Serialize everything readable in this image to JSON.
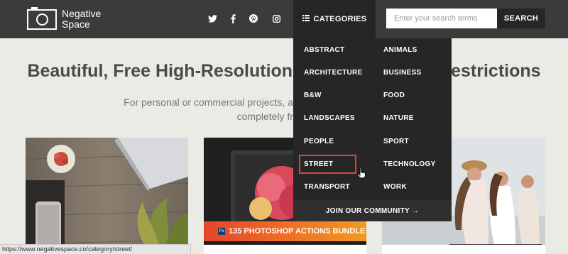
{
  "header": {
    "logo_line1": "Negative",
    "logo_line2": "Space",
    "social_icons": [
      "twitter-icon",
      "facebook-icon",
      "pinterest-icon",
      "instagram-icon"
    ],
    "categories_label": "CATEGORIES",
    "search_placeholder": "Enter your search terms",
    "search_button": "SEARCH"
  },
  "hero": {
    "title_left": "Beautiful, Free High-Resolution",
    "title_right": "Restrictions",
    "sub_line1_left": "For personal or commercial projects, a",
    "sub_line2_left": "completely fr"
  },
  "dropdown": {
    "left_items": [
      "ABSTRACT",
      "ARCHITECTURE",
      "B&W",
      "LANDSCAPES",
      "PEOPLE",
      "STREET",
      "TRANSPORT"
    ],
    "right_items": [
      "ANIMALS",
      "BUSINESS",
      "FOOD",
      "NATURE",
      "SPORT",
      "TECHNOLOGY",
      "WORK"
    ],
    "footer": "JOIN OUR COMMUNITY →",
    "highlighted": "STREET"
  },
  "cards": {
    "banner_badge": "Ps",
    "banner_text": "135 PHOTOSHOP ACTIONS BUNDLE"
  },
  "status_url": "https://www.negativespace.co/category/street/",
  "colors": {
    "header_bg": "#3b3b3b",
    "dropdown_bg": "#262626",
    "page_bg": "#ebebe6",
    "highlight_border": "#d94444"
  }
}
